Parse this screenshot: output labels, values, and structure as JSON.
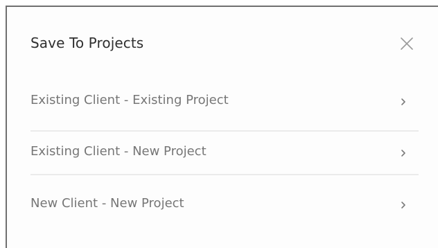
{
  "dialog": {
    "title": "Save To Projects",
    "close_icon": "close-icon",
    "options": [
      {
        "label": "Existing Client - Existing Project",
        "icon": "chevron-right-icon"
      },
      {
        "label": "Existing Client - New Project",
        "icon": "chevron-right-icon"
      },
      {
        "label": "New Client - New Project",
        "icon": "chevron-right-icon"
      }
    ]
  }
}
